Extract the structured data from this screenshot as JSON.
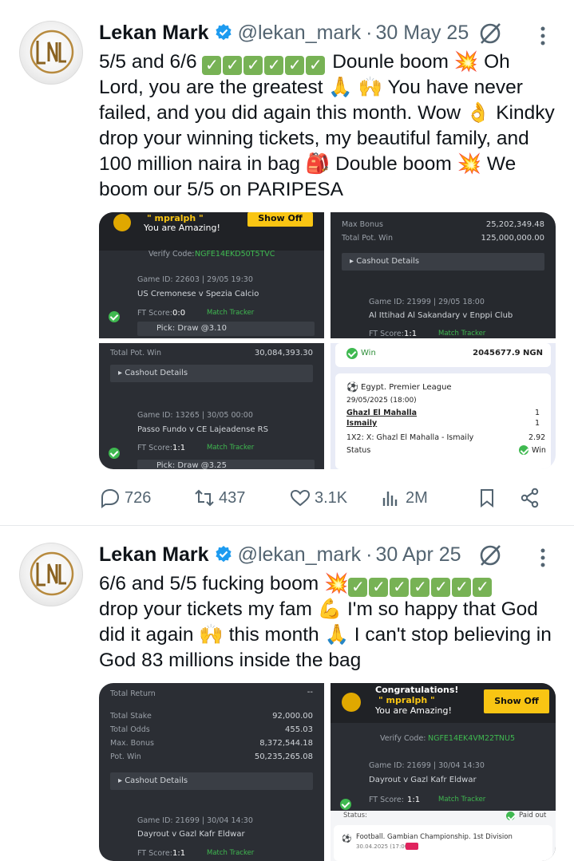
{
  "tweets": [
    {
      "author_name": "Lekan Mark",
      "handle": "@lekan_mark",
      "date": "30 May 25",
      "text_lines": [
        {
          "pre": "5/5 and 6/6 ",
          "checks": 6,
          "post": "  Dounle boom 💥 Oh"
        },
        {
          "pre": "Lord, you are the greatest 🙏 🙌  You have never"
        },
        {
          "pre": "failed, and you did again this month. Wow 👌 Kindky"
        },
        {
          "pre": "drop your winning tickets, my beautiful family, and"
        },
        {
          "pre": "100 million naira in bag 🎒 Double boom 💥 We"
        },
        {
          "pre": "boom our 5/5 on PARIPESA"
        }
      ],
      "tickets": {
        "a": {
          "user": "\" mpralph \"",
          "tagline": "You are Amazing!",
          "show_off": "Show Off",
          "verify": "Verify Code:",
          "verify_code": "NGFE14EKD50T5TVC",
          "game": "Game ID: 22603 | 29/05 19:30",
          "match": "US Cremonese v Spezia Calcio",
          "ft": "FT Score:",
          "score": "0:0",
          "tracker": "Match Tracker",
          "pick": "Pick:  Draw @3.10"
        },
        "b": {
          "max_bonus_label": "Max Bonus",
          "max_bonus": "25,202,349.48",
          "total_pot_label": "Total Pot. Win",
          "total_pot": "125,000,000.00",
          "cashout": "Cashout Details",
          "game": "Game ID: 21999 | 29/05 18:00",
          "match": "Al Ittihad Al Sakandary v Enppi Club",
          "ft": "FT Score:",
          "score": "1:1",
          "tracker": "Match Tracker"
        },
        "c": {
          "total_pot_label": "Total Pot. Win",
          "total_pot": "30,084,393.30",
          "cashout": "Cashout Details",
          "game": "Game ID: 13265 | 30/05 00:00",
          "match": "Passo Fundo v CE Lajeadense RS",
          "ft": "FT Score:",
          "score": "1:1",
          "tracker": "Match Tracker",
          "pick": "Pick:  Draw @3.25"
        },
        "d": {
          "win_label": "Win",
          "win_amount": "2045677.9 NGN",
          "league": "Egypt. Premier League",
          "date": "29/05/2025 (18:00)",
          "team1": "Ghazl El Mahalla",
          "team2": "Ismaily",
          "s1": "1",
          "s2": "1",
          "bet": "1X2: X: Ghazl El Mahalla - Ismaily",
          "odds": "2.92",
          "status_label": "Status",
          "status": "Win"
        }
      },
      "stats": {
        "replies": "726",
        "reposts": "437",
        "likes": "3.1K",
        "views": "2M"
      }
    },
    {
      "author_name": "Lekan Mark",
      "handle": "@lekan_mark",
      "date": "30 Apr 25",
      "text_lines": [
        {
          "pre": "6/6 and 5/5 fucking boom 💥",
          "checks": 7,
          "post": ""
        },
        {
          "pre": "drop your tickets my fam 💪 I'm so happy that God"
        },
        {
          "pre": "did it again 🙌 this month 🙏 I can't stop believing in"
        },
        {
          "pre": "God  83 millions inside the bag"
        }
      ],
      "tickets": {
        "e": {
          "total_return": "Total Return",
          "total_return_val": "--",
          "stake_label": "Total Stake",
          "stake": "92,000.00",
          "odds_label": "Total Odds",
          "odds": "455.03",
          "bonus_label": "Max. Bonus",
          "bonus": "8,372,544.18",
          "pot_label": "Pot. Win",
          "pot": "50,235,265.08",
          "cashout": "Cashout Details",
          "game": "Game ID: 21699 | 30/04 14:30",
          "match": "Dayrout v Gazl Kafr Eldwar",
          "ft": "FT Score:",
          "score": "1:1",
          "tracker": "Match Tracker"
        },
        "f": {
          "congrats": "Congratulations!",
          "user": "\" mpralph \"",
          "tagline": "You are Amazing!",
          "show_off": "Show Off",
          "verify": "Verify Code:",
          "verify_code": "NGFE14EK4VM22TNU5",
          "game": "Game ID: 21699 | 30/04 14:30",
          "match": "Dayrout v Gazl Kafr Eldwar",
          "ft": "FT Score:",
          "score": "1:1",
          "tracker": "Match Tracker",
          "status_label": "Status:",
          "paid": "Paid out",
          "league": "Football. Gambian Championship. 1st Division",
          "league_date": "30.04.2025 (17:00)"
        }
      }
    }
  ],
  "colors": {
    "accent": "#1d9bf0",
    "muted": "#536471",
    "check_green": "#77b255",
    "ticket_yellow": "#f9c513",
    "ticket_dark": "#2b2e34"
  }
}
